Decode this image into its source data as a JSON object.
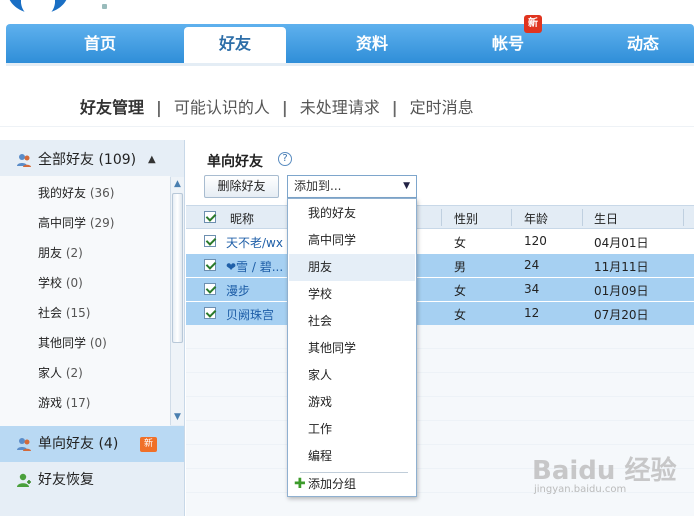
{
  "nav": {
    "items": [
      {
        "label": "首页"
      },
      {
        "label": "好友"
      },
      {
        "label": "资料"
      },
      {
        "label": "帐号"
      },
      {
        "label": "动态"
      }
    ],
    "badge": "新"
  },
  "subnav": {
    "items": [
      "好友管理",
      "可能认识的人",
      "未处理请求",
      "定时消息"
    ]
  },
  "sidebar": {
    "all_friends": "全部好友 (109)",
    "groups": [
      {
        "name": "我的好友",
        "count": "(36)"
      },
      {
        "name": "高中同学",
        "count": "(29)"
      },
      {
        "name": "朋友",
        "count": "(2)"
      },
      {
        "name": "学校",
        "count": "(0)"
      },
      {
        "name": "社会",
        "count": "(15)"
      },
      {
        "name": "其他同学",
        "count": "(0)"
      },
      {
        "name": "家人",
        "count": "(2)"
      },
      {
        "name": "游戏",
        "count": "(17)"
      }
    ],
    "one_way": "单向好友 (4)",
    "one_way_badge": "新",
    "recover": "好友恢复"
  },
  "main": {
    "title": "单向好友",
    "help": "?",
    "delete_button": "删除好友",
    "add_to_select": "添加到...",
    "columns": [
      "昵称",
      "性别",
      "年龄",
      "生日"
    ],
    "rows": [
      {
        "nick": "天不老/wx",
        "gender": "女",
        "age": "120",
        "birthday": "04月01日"
      },
      {
        "nick": "❤雪 / 碧...",
        "gender": "男",
        "age": "24",
        "birthday": "11月11日"
      },
      {
        "nick": "漫步",
        "gender": "女",
        "age": "34",
        "birthday": "01月09日"
      },
      {
        "nick": "贝阙珠宫",
        "gender": "女",
        "age": "12",
        "birthday": "07月20日"
      }
    ]
  },
  "dropdown": {
    "options": [
      "我的好友",
      "高中同学",
      "朋友",
      "学校",
      "社会",
      "其他同学",
      "家人",
      "游戏",
      "工作",
      "编程"
    ],
    "add_group": "添加分组"
  },
  "watermark": {
    "text": "Baidu 经验",
    "sub": "jingyan.baidu.com"
  }
}
